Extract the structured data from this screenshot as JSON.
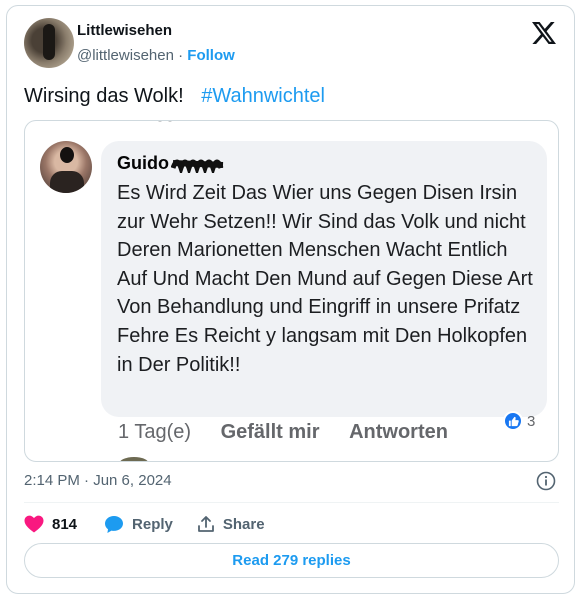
{
  "author": {
    "name": "Littlewisehen",
    "handle": "@littlewisehen",
    "separator": "·",
    "follow_label": "Follow"
  },
  "tweet": {
    "text": "Wirsing das Wolk!",
    "hashtag": "#Wahnwichtel"
  },
  "embedded_comment": {
    "author_name": "Guido",
    "body": "Es Wird Zeit Das Wier  uns Gegen Disen Irsin zur Wehr Setzen!! Wir Sind das Volk und nicht Deren Marionetten Menschen Wacht Entlich Auf Und Macht Den Mund auf Gegen Diese Art Von Behandlung und Eingriff in unsere Prifatz Fehre Es Reicht y langsam mit Den Holkopfen in Der Politik!!",
    "time": "1 Tag(e)",
    "like_action": "Gefällt mir",
    "reply_action": "Antworten",
    "like_count": "3"
  },
  "meta": {
    "timestamp": "2:14 PM · Jun 6, 2024"
  },
  "actions": {
    "likes": "814",
    "reply_label": "Reply",
    "share_label": "Share"
  },
  "read_replies_label": "Read 279 replies",
  "colors": {
    "accent": "#1d9bf0",
    "heart": "#f91880",
    "facebook_blue": "#1877f2"
  },
  "icons": [
    "x-logo-icon",
    "info-icon",
    "heart-icon",
    "reply-bubble-icon",
    "share-icon",
    "thumbs-up-icon"
  ]
}
